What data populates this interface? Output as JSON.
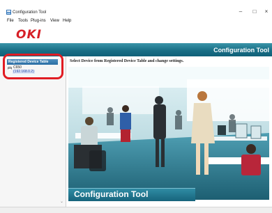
{
  "window": {
    "title": "Configuration Tool",
    "minimize_glyph": "–",
    "maximize_glyph": "□",
    "close_glyph": "×"
  },
  "menu": [
    {
      "label": "File"
    },
    {
      "label": "Tools"
    },
    {
      "label": "Plug-ins"
    },
    {
      "label": "View"
    },
    {
      "label": "Help"
    }
  ],
  "brand": {
    "logo_text": "OKI",
    "banner_title": "Configuration Tool",
    "logo_color": "#d61f26",
    "accent_color": "#1a6f86"
  },
  "sidebar": {
    "header": "Registered Device Table",
    "devices": [
      {
        "name": "C650",
        "ip": "(192.168.0.2)",
        "icon": "printer-icon"
      }
    ],
    "highlight_color": "#e11b22"
  },
  "main": {
    "instruction": "Select Device from Registered Device Table and change settings.",
    "hero_title": "Configuration Tool"
  }
}
